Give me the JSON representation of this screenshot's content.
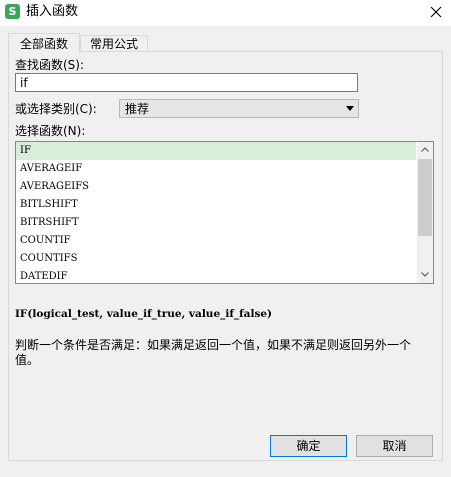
{
  "window": {
    "title": "插入函数",
    "app_icon_letter": "S",
    "app_icon_color": "#3aa55d",
    "close_icon": "close-icon"
  },
  "tabs": [
    {
      "label": "全部函数",
      "active": true
    },
    {
      "label": "常用公式",
      "active": false
    }
  ],
  "search": {
    "label": "查找函数(S):",
    "value": "if"
  },
  "category": {
    "label": "或选择类别(C):",
    "selected": "推荐"
  },
  "function_list": {
    "label": "选择函数(N):",
    "items": [
      "IF",
      "AVERAGEIF",
      "AVERAGEIFS",
      "BITLSHIFT",
      "BITRSHIFT",
      "COUNTIF",
      "COUNTIFS",
      "DATEDIF"
    ],
    "selected_index": 0,
    "selection_color": "#d8eed8"
  },
  "function_info": {
    "signature": "IF(logical_test, value_if_true, value_if_false)",
    "description": "判断一个条件是否满足：如果满足返回一个值，如果不满足则返回另外一个值。"
  },
  "buttons": {
    "ok": "确定",
    "cancel": "取消"
  }
}
